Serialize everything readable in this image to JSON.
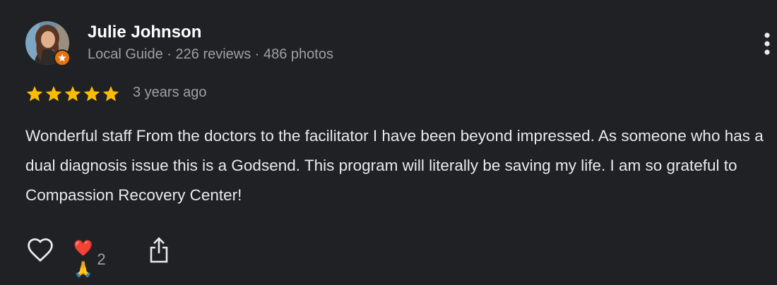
{
  "review": {
    "author": {
      "name": "Julie Johnson",
      "meta": "Local Guide · 226 reviews · 486 photos",
      "avatar_icon": "user-photo-avatar",
      "badge_icon": "local-guide-star-badge",
      "badge_color": "#e8710a"
    },
    "rating": 5,
    "rating_max": 5,
    "star_color": "#fbbc04",
    "time": "3 years ago",
    "text": "Wonderful staff From the doctors to the facilitator I have been beyond impressed. As someone who has a dual diagnosis issue this is a Godsend. This program will literally be saving my life. I am so grateful to Compassion Recovery Center!",
    "actions": {
      "like_icon": "heart-outline-icon",
      "reaction_emojis": "❤️🙏",
      "reaction_count": "2",
      "share_icon": "share-icon",
      "more_icon": "more-vertical-icon"
    }
  },
  "colors": {
    "background": "#202124",
    "primary_text": "#e8eaed",
    "secondary_text": "#9aa0a6",
    "name_text": "#ffffff"
  }
}
